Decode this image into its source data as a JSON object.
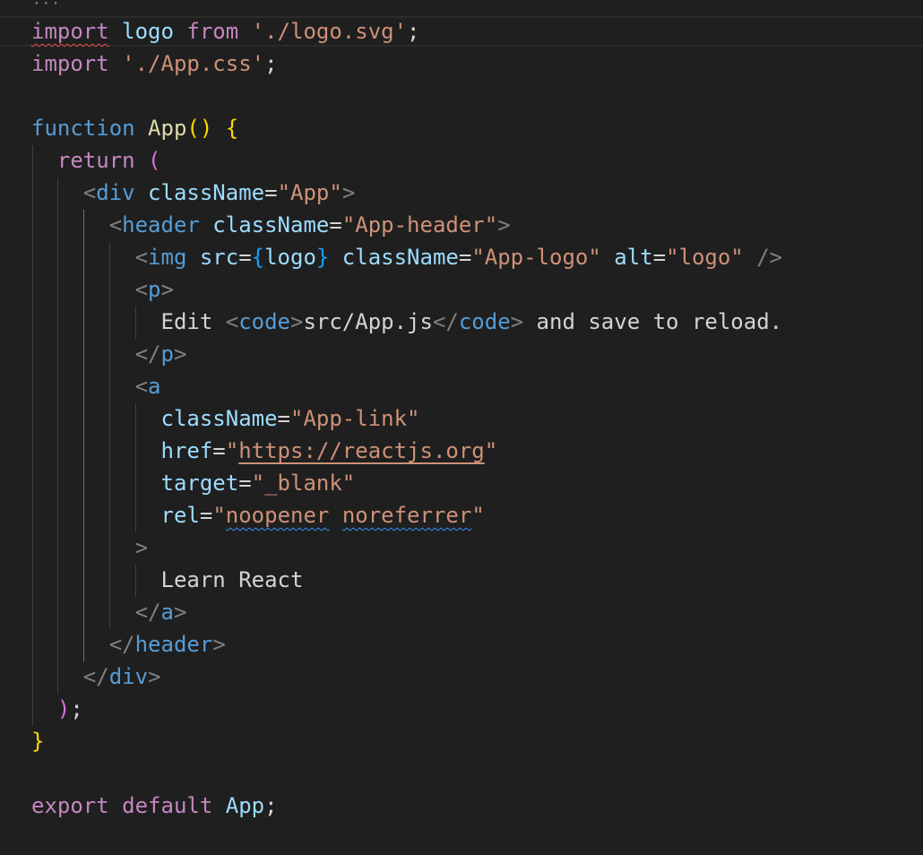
{
  "editor": {
    "fold_marker": "···",
    "lines": {
      "l1": {
        "t1": "import",
        "t2": " logo ",
        "t3": "from",
        "t4": " './logo.svg'",
        "t5": ";"
      },
      "l2": {
        "t1": "import",
        "t2": " './App.css'",
        "t3": ";"
      },
      "l4": {
        "t1": "function",
        "t2": " App",
        "t3": "()",
        "t4": " {"
      },
      "l5": {
        "t1": "return",
        "t2": " ("
      },
      "l6": {
        "t1": "<",
        "t2": "div",
        "t3": " className",
        "t4": "=",
        "t5": "\"App\"",
        "t6": ">"
      },
      "l7": {
        "t1": "<",
        "t2": "header",
        "t3": " className",
        "t4": "=",
        "t5": "\"App-header\"",
        "t6": ">"
      },
      "l8": {
        "t1": "<",
        "t2": "img",
        "t3": " src",
        "t4": "=",
        "t5": "{",
        "t6": "logo",
        "t7": "}",
        "t8": " className",
        "t9": "=",
        "t10": "\"App-logo\"",
        "t11": " alt",
        "t12": "=",
        "t13": "\"logo\"",
        "t14": " />"
      },
      "l9": {
        "t1": "<",
        "t2": "p",
        "t3": ">"
      },
      "l10": {
        "t1": "Edit ",
        "t2": "<",
        "t3": "code",
        "t4": ">",
        "t5": "src/App.js",
        "t6": "</",
        "t7": "code",
        "t8": ">",
        "t9": " and save to reload."
      },
      "l11": {
        "t1": "</",
        "t2": "p",
        "t3": ">"
      },
      "l12": {
        "t1": "<",
        "t2": "a"
      },
      "l13": {
        "t1": "className",
        "t2": "=",
        "t3": "\"App-link\""
      },
      "l14": {
        "t1": "href",
        "t2": "=",
        "t3": "\"",
        "t4": "https://reactjs.org",
        "t5": "\""
      },
      "l15": {
        "t1": "target",
        "t2": "=",
        "t3": "\"_blank\""
      },
      "l16": {
        "t1": "rel",
        "t2": "=",
        "t3": "\"",
        "t4": "noopener",
        "t5": " ",
        "t6": "noreferrer",
        "t7": "\""
      },
      "l17": {
        "t1": ">"
      },
      "l18": {
        "t1": "Learn React"
      },
      "l19": {
        "t1": "</",
        "t2": "a",
        "t3": ">"
      },
      "l20": {
        "t1": "</",
        "t2": "header",
        "t3": ">"
      },
      "l21": {
        "t1": "</",
        "t2": "div",
        "t3": ">"
      },
      "l22": {
        "t1": ")",
        "t2": ";"
      },
      "l23": {
        "t1": "}"
      },
      "l25": {
        "t1": "export",
        "t2": " default",
        "t3": " App",
        "t4": ";"
      }
    }
  },
  "colors": {
    "background": "#1f1f1f",
    "keyword_control": "#c586c0",
    "keyword_storage": "#569cd6",
    "function_name": "#dcdcaa",
    "variable": "#9cdcfe",
    "string": "#ce9178",
    "tag_bracket": "#808080",
    "bracket_gold": "#ffd700",
    "bracket_pink": "#da70d6",
    "bracket_blue": "#179fff",
    "error_squiggle": "#f14c4c",
    "info_squiggle": "#3794ff"
  }
}
